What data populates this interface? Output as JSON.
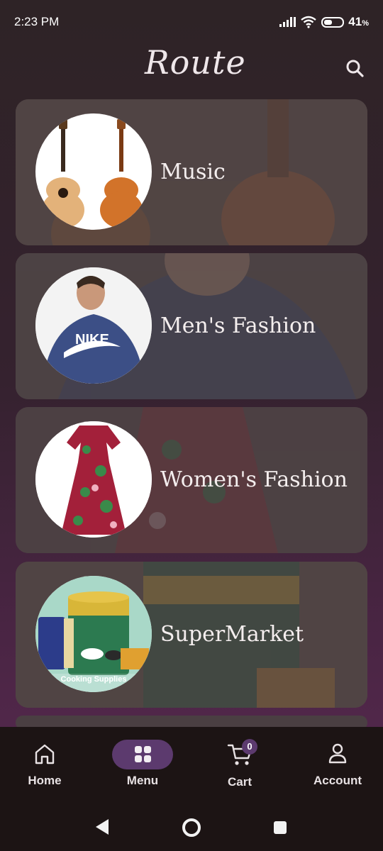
{
  "status_bar": {
    "time": "2:23 PM",
    "battery": "41",
    "battery_unit": "%"
  },
  "header": {
    "logo_text": "Route",
    "search_icon": "search-icon"
  },
  "categories": [
    {
      "label": "Music",
      "image": "guitars"
    },
    {
      "label": "Men's Fashion",
      "image": "man-in-hoodie"
    },
    {
      "label": "Women's Fashion",
      "image": "floral-dress"
    },
    {
      "label": "SuperMarket",
      "image": "cooking-supplies",
      "image_caption": "Cooking Supplies"
    }
  ],
  "bottom_nav": {
    "items": [
      {
        "label": "Home",
        "icon": "home-icon"
      },
      {
        "label": "Menu",
        "icon": "grid-icon",
        "active": true
      },
      {
        "label": "Cart",
        "icon": "cart-icon",
        "badge": "0"
      },
      {
        "label": "Account",
        "icon": "user-icon"
      }
    ]
  },
  "colors": {
    "accent": "#5c3a6e",
    "nav_bg": "#1c1414"
  }
}
